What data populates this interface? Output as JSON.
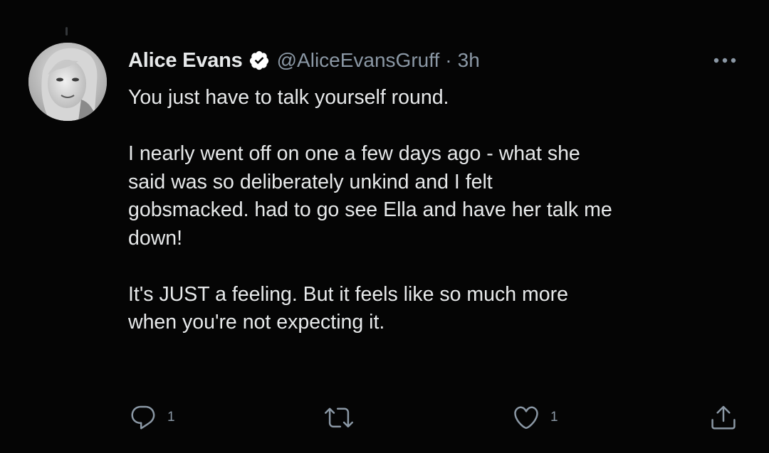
{
  "tweet": {
    "display_name": "Alice Evans",
    "handle": "@AliceEvansGruff",
    "separator": "·",
    "timestamp": "3h",
    "verified": true,
    "paragraphs": [
      [
        "You just have to talk yourself round."
      ],
      [
        "I nearly went off on one a few days ago - what she",
        "said was so deliberately unkind and I felt",
        "gobsmacked. had to go see Ella and have her talk me",
        "down!"
      ],
      [
        "It's JUST a feeling. But it feels like so much more",
        "when you're not expecting it."
      ]
    ]
  },
  "actions": {
    "reply_count": "1",
    "retweet_count": "",
    "like_count": "1"
  },
  "icons": {
    "verified": "verified-badge-icon",
    "more": "more-options-icon",
    "reply": "reply-icon",
    "retweet": "retweet-icon",
    "like": "like-heart-icon",
    "share": "share-icon"
  },
  "colors": {
    "background": "#050505",
    "text": "#e7e9ea",
    "secondary": "#8b98a5"
  }
}
